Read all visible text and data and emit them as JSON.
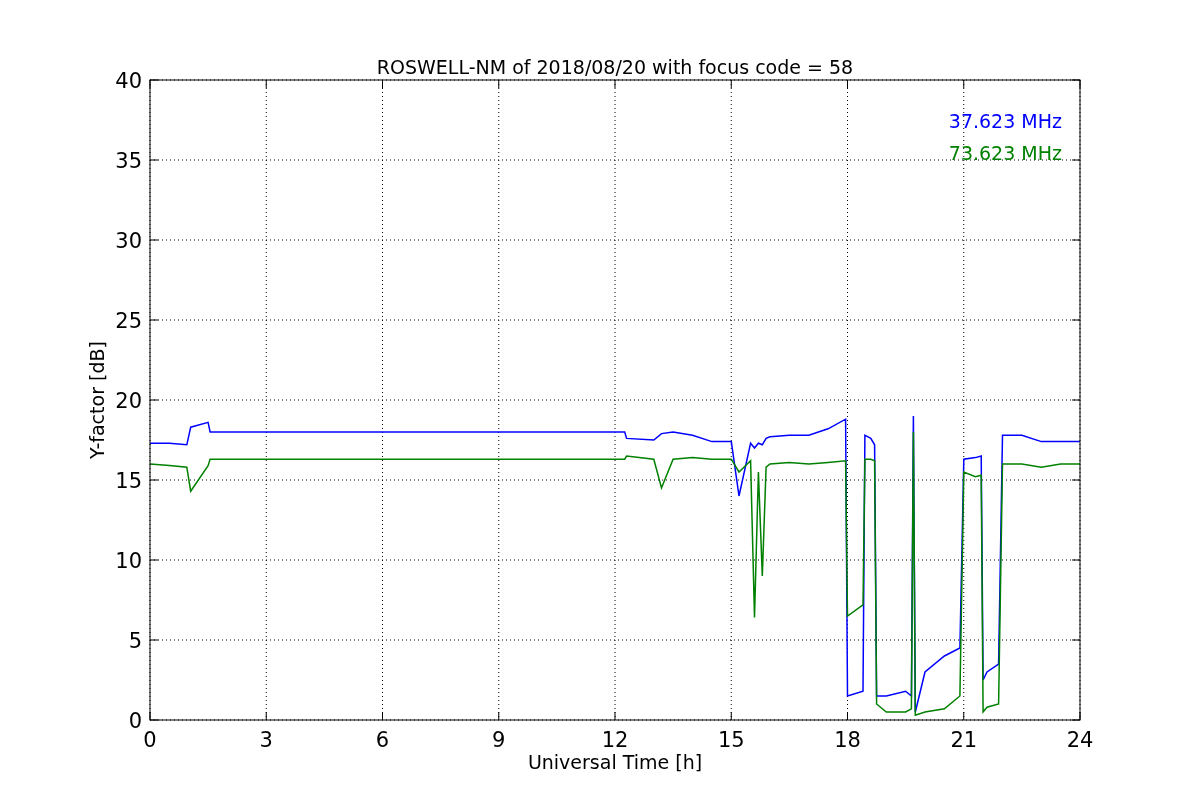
{
  "chart_data": {
    "type": "line",
    "title": "ROSWELL-NM of 2018/08/20 with focus code = 58",
    "xlabel": "Universal Time [h]",
    "ylabel": "Y-factor [dB]",
    "x": [
      0,
      0.5,
      0.95,
      1.05,
      1.5,
      1.55,
      3,
      6,
      9,
      12,
      12.25,
      12.3,
      13,
      13.2,
      13.5,
      14,
      14.5,
      15,
      15.2,
      15.5,
      15.6,
      15.7,
      15.8,
      15.9,
      16,
      16.5,
      17,
      17.5,
      17.95,
      18.0,
      18.4,
      18.45,
      18.6,
      18.7,
      18.75,
      19,
      19.5,
      19.65,
      19.7,
      19.75,
      20,
      20.5,
      20.9,
      21.0,
      21.3,
      21.45,
      21.5,
      21.6,
      21.9,
      22.0,
      22.5,
      23,
      23.5,
      24
    ],
    "series": [
      {
        "name": "37.623 MHz",
        "color": "#0000ff",
        "values": [
          17.3,
          17.3,
          17.2,
          18.3,
          18.6,
          18.0,
          18,
          18,
          18,
          18,
          18.0,
          17.6,
          17.5,
          17.9,
          18.0,
          17.8,
          17.4,
          17.4,
          14,
          17.3,
          17.0,
          17.3,
          17.2,
          17.6,
          17.7,
          17.8,
          17.8,
          18.2,
          18.8,
          1.5,
          1.8,
          17.8,
          17.6,
          17.2,
          1.5,
          1.5,
          1.8,
          1.5,
          19,
          0.5,
          3,
          4,
          4.5,
          16.3,
          16.4,
          16.5,
          2.5,
          3,
          3.5,
          17.8,
          17.8,
          17.4,
          17.4,
          17.4
        ]
      },
      {
        "name": "73.623 MHz",
        "color": "#008000",
        "values": [
          16.0,
          15.9,
          15.8,
          14.3,
          15.9,
          16.3,
          16.3,
          16.3,
          16.3,
          16.3,
          16.3,
          16.5,
          16.3,
          14.5,
          16.3,
          16.4,
          16.3,
          16.3,
          15.5,
          16.2,
          6.4,
          15.5,
          9,
          15.8,
          16,
          16.1,
          16,
          16.1,
          16.2,
          6.5,
          7.2,
          16.3,
          16.3,
          16.2,
          1,
          0.5,
          0.5,
          0.7,
          18,
          0.3,
          0.5,
          0.7,
          1.5,
          15.5,
          15.2,
          15.3,
          0.5,
          0.8,
          1,
          16,
          16,
          15.8,
          16,
          16
        ]
      }
    ],
    "xlim": [
      0,
      24
    ],
    "ylim": [
      0,
      40
    ],
    "xticks": [
      0,
      3,
      6,
      9,
      12,
      15,
      18,
      21,
      24
    ],
    "yticks": [
      0,
      5,
      10,
      15,
      20,
      25,
      30,
      35,
      40
    ],
    "grid": true
  }
}
